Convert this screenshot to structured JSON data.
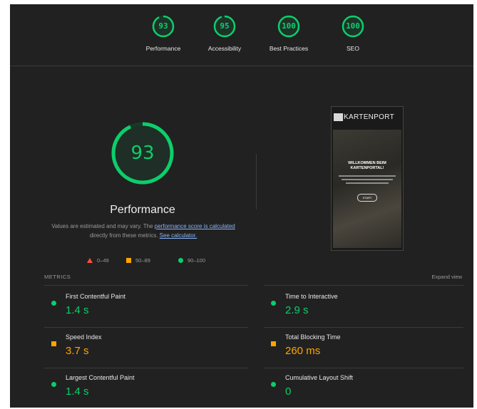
{
  "top_gauges": [
    {
      "score": "93",
      "label": "Performance",
      "fraction": 0.93
    },
    {
      "score": "95",
      "label": "Accessibility",
      "fraction": 0.95
    },
    {
      "score": "100",
      "label": "Best Practices",
      "fraction": 1.0
    },
    {
      "score": "100",
      "label": "SEO",
      "fraction": 1.0
    }
  ],
  "main_gauge": {
    "score": "93",
    "fraction": 0.93,
    "title": "Performance"
  },
  "description": {
    "part1": "Values are estimated and may vary. The ",
    "link1": "performance score is calculated",
    "part2": " directly from these metrics. ",
    "link2": "See calculator."
  },
  "legend": [
    {
      "range": "0–49",
      "shape": "triangle",
      "color": "#ff4e42"
    },
    {
      "range": "50–89",
      "shape": "square",
      "color": "#ffa400"
    },
    {
      "range": "90–100",
      "shape": "circle",
      "color": "#0cce6b"
    }
  ],
  "screenshot": {
    "logo_text": "KARTENPORT",
    "welcome_line1": "WILLKOMMEN BEIM",
    "welcome_line2": "KARTENPORTAL!",
    "start_label": "START"
  },
  "metrics_header": "METRICS",
  "expand_view": "Expand view",
  "metrics": [
    {
      "name": "First Contentful Paint",
      "value": "1.4 s",
      "status": "pass"
    },
    {
      "name": "Time to Interactive",
      "value": "2.9 s",
      "status": "pass"
    },
    {
      "name": "Speed Index",
      "value": "3.7 s",
      "status": "average"
    },
    {
      "name": "Total Blocking Time",
      "value": "260 ms",
      "status": "average"
    },
    {
      "name": "Largest Contentful Paint",
      "value": "1.4 s",
      "status": "pass"
    },
    {
      "name": "Cumulative Layout Shift",
      "value": "0",
      "status": "pass"
    }
  ],
  "colors": {
    "pass": "#0cce6b",
    "average": "#ffa400",
    "fail": "#ff4e42",
    "background": "#212121"
  }
}
